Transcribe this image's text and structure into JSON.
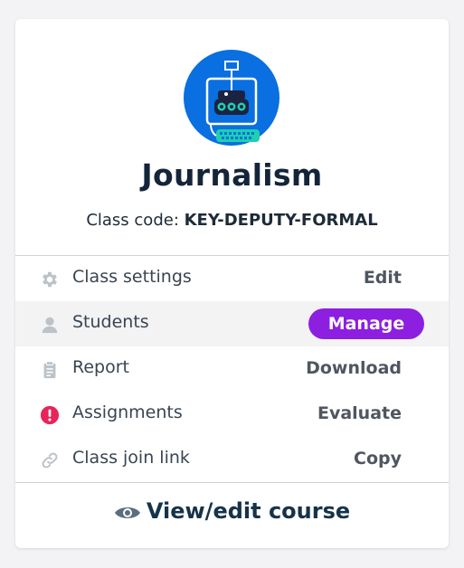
{
  "class": {
    "name": "Journalism",
    "code_prefix": "Class code: ",
    "code": "KEY-DEPUTY-FORMAL"
  },
  "rows": [
    {
      "label": "Class settings",
      "action": "Edit",
      "icon": "gear-icon"
    },
    {
      "label": "Students",
      "action": "Manage",
      "icon": "person-icon"
    },
    {
      "label": "Report",
      "action": "Download",
      "icon": "clipboard-icon"
    },
    {
      "label": "Assignments",
      "action": "Evaluate",
      "icon": "alert-icon"
    },
    {
      "label": "Class join link",
      "action": "Copy",
      "icon": "link-icon"
    }
  ],
  "footer": {
    "label": "View/edit course",
    "icon": "eye-icon"
  },
  "colors": {
    "accent": "#8d1fe0",
    "avatar_bg": "#0a6fe0",
    "alert": "#e8245a",
    "teal": "#1fd0b0"
  }
}
